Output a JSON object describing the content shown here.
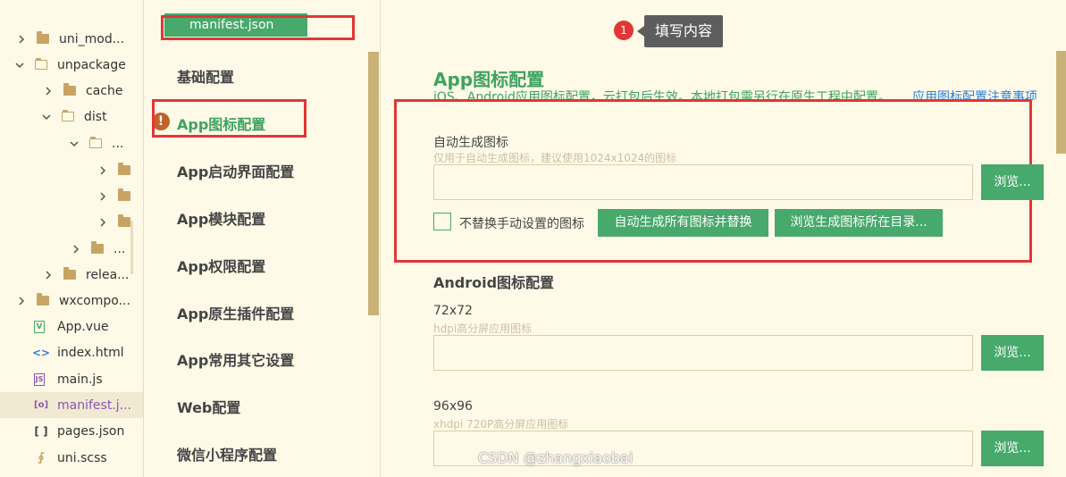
{
  "tree": {
    "items": [
      {
        "label": "uni_mod...",
        "chevron": "right",
        "icon": "folder"
      },
      {
        "label": "unpackage",
        "chevron": "down",
        "icon": "folder-open"
      },
      {
        "label": "cache",
        "chevron": "right",
        "icon": "folder"
      },
      {
        "label": "dist",
        "chevron": "down",
        "icon": "folder-open"
      },
      {
        "label": "...",
        "chevron": "down",
        "icon": "folder-open"
      },
      {
        "label": "",
        "chevron": "right",
        "icon": "folder"
      },
      {
        "label": "",
        "chevron": "right",
        "icon": "folder"
      },
      {
        "label": "",
        "chevron": "right",
        "icon": "folder"
      },
      {
        "label": "...",
        "chevron": "right",
        "icon": "folder"
      },
      {
        "label": "relea...",
        "chevron": "right",
        "icon": "folder"
      },
      {
        "label": "wxcompo...",
        "chevron": "right",
        "icon": "folder"
      },
      {
        "label": "App.vue",
        "chevron": "none",
        "icon": "vue-file-icon"
      },
      {
        "label": "index.html",
        "chevron": "none",
        "icon": "html-file-icon"
      },
      {
        "label": "main.js",
        "chevron": "none",
        "icon": "js-file-icon"
      },
      {
        "label": "manifest.j...",
        "chevron": "none",
        "icon": "manifest-file-icon"
      },
      {
        "label": "pages.json",
        "chevron": "none",
        "icon": "json-file-icon"
      },
      {
        "label": "uni.scss",
        "chevron": "none",
        "icon": "scss-file-icon"
      }
    ]
  },
  "nav": {
    "file_tab": "manifest.json",
    "items": [
      "基础配置",
      "App图标配置",
      "App启动界面配置",
      "App模块配置",
      "App权限配置",
      "App原生插件配置",
      "App常用其它设置",
      "Web配置",
      "微信小程序配置"
    ],
    "warning_glyph": "!"
  },
  "tooltip": {
    "badge": "1",
    "text": "填写内容"
  },
  "main": {
    "title": "App图标配置",
    "desc": "iOS、Android应用图标配置，云打包后生效。本地打包需另行在原生工程中配置。",
    "link": "应用图标配置注意事项",
    "auto": {
      "label": "自动生成图标",
      "hint": "仅用于自动生成图标，建议使用1024x1024的图标",
      "value": "",
      "browse": "浏览...",
      "checkbox_label": "不替换手动设置的图标",
      "gen_button": "自动生成所有图标并替换",
      "open_dir_button": "浏览生成图标所在目录..."
    },
    "android_title": "Android图标配置",
    "fields": [
      {
        "label": "72x72",
        "hint": "hdpi高分屏应用图标",
        "value": "",
        "browse": "浏览..."
      },
      {
        "label": "96x96",
        "hint": "xhdpi 720P高分屏应用图标",
        "value": "",
        "browse": "浏览..."
      }
    ]
  },
  "watermark": "CSDN @zhangxiaobai",
  "colors": {
    "accent": "#47a96b",
    "highlight": "#e23636",
    "background": "#fffae8"
  }
}
